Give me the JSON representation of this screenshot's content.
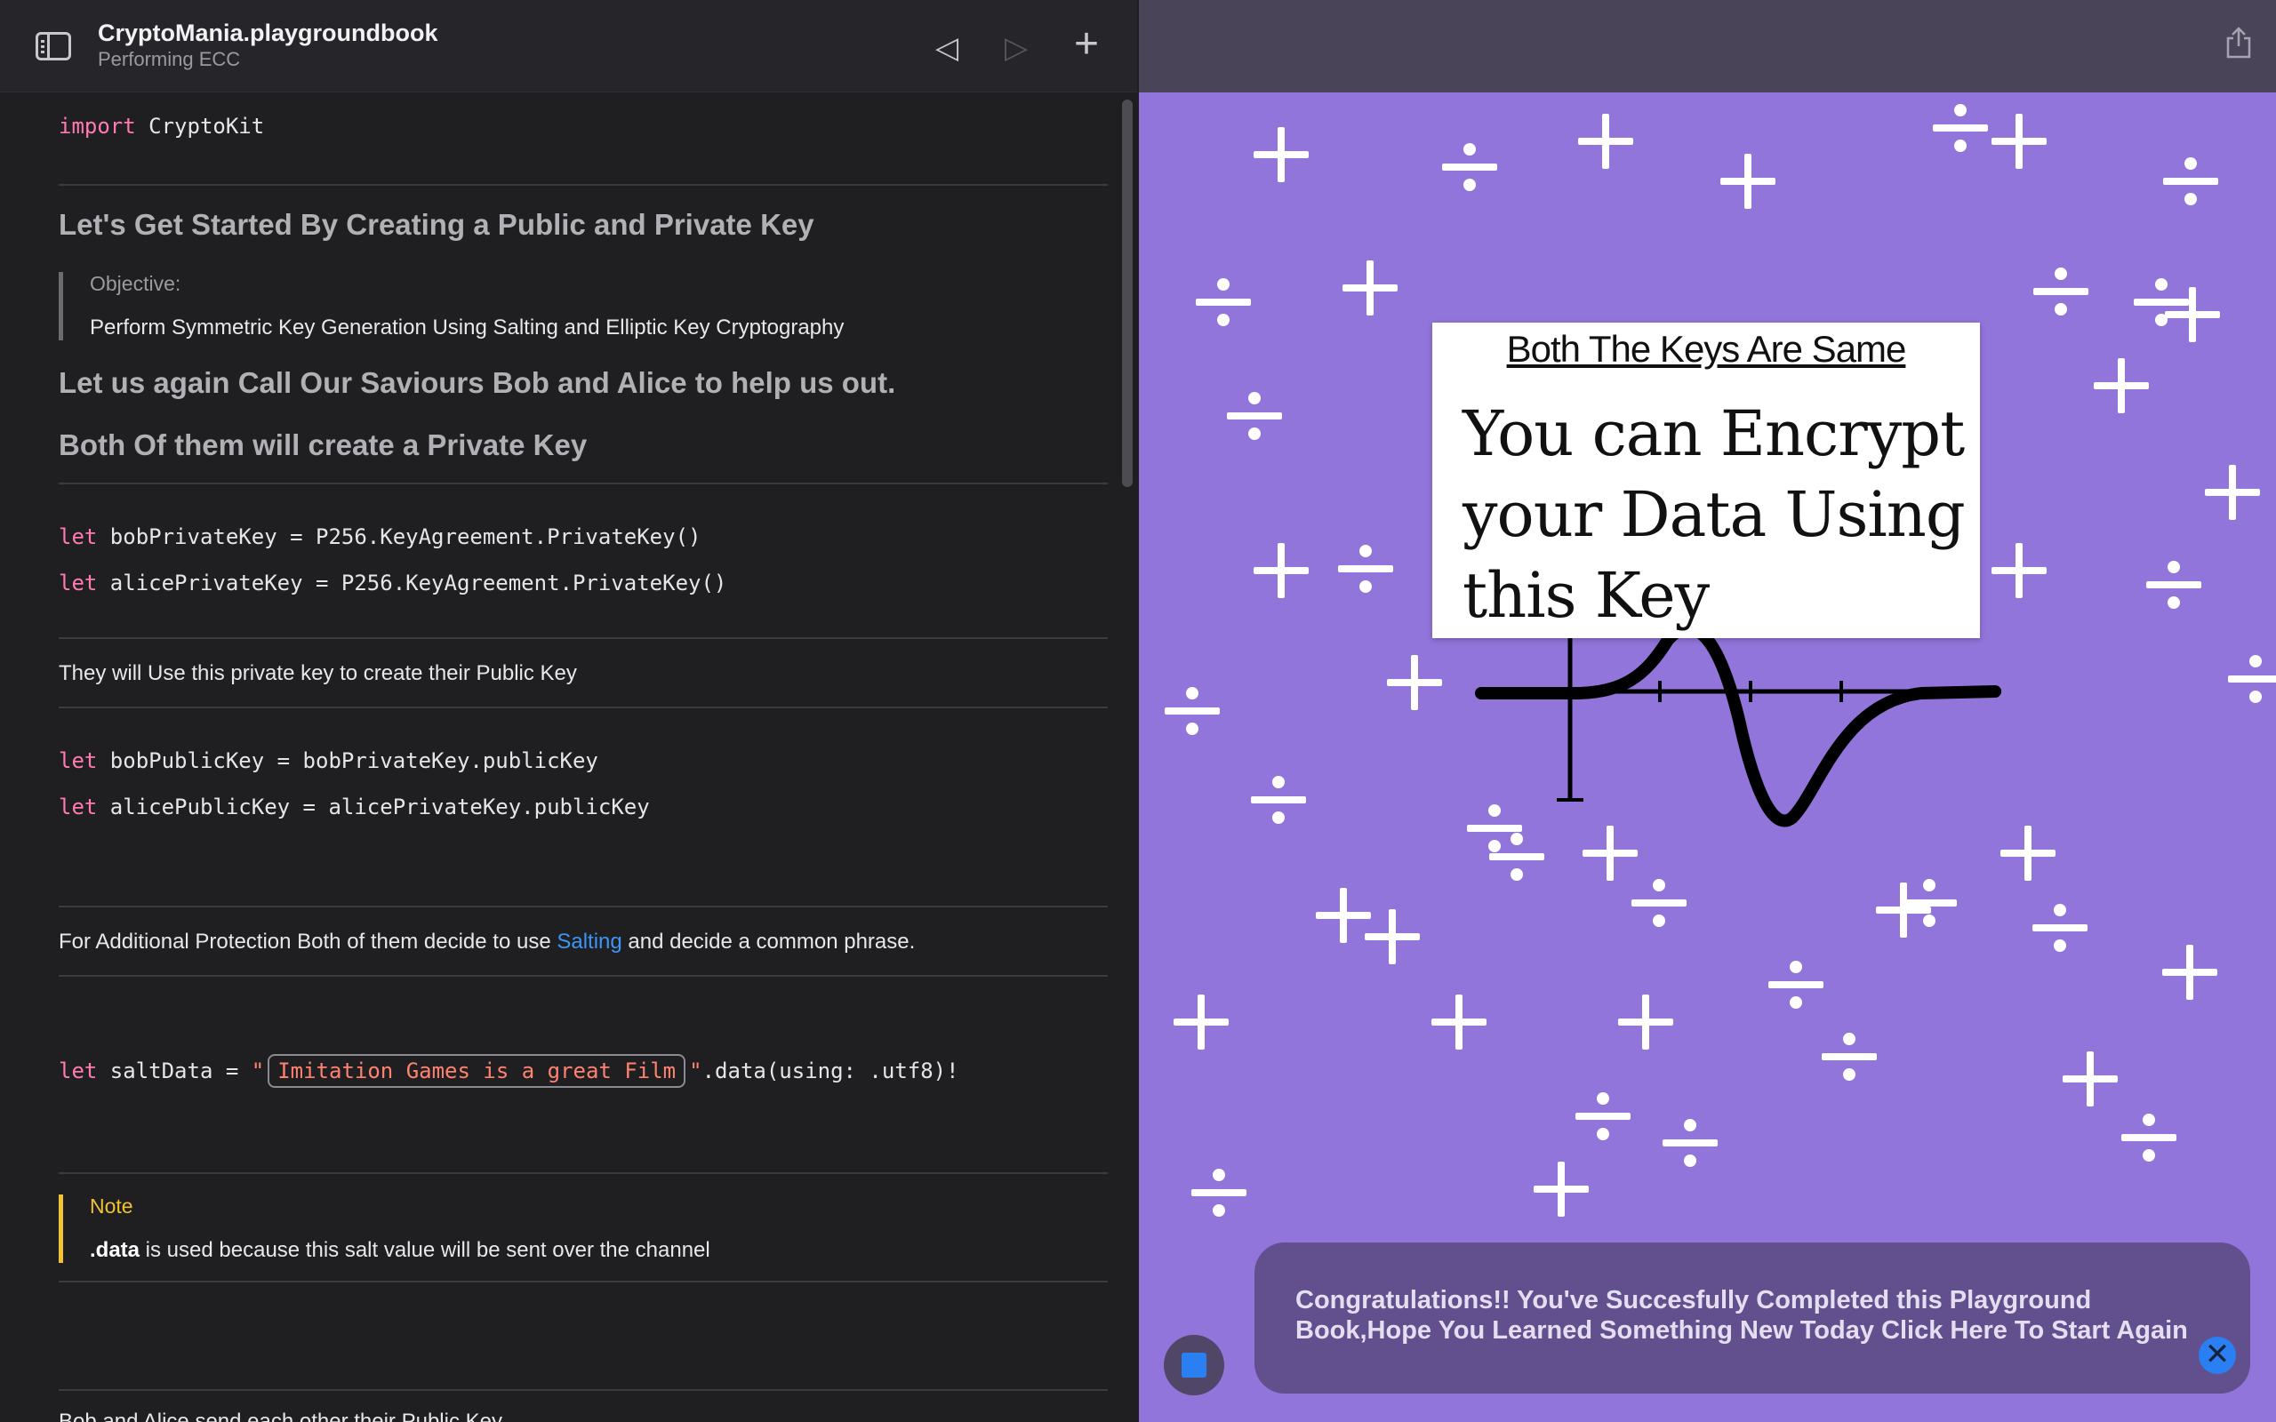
{
  "editor": {
    "title": "CryptoMania.playgroundbook",
    "subtitle": "Performing ECC",
    "icons": {
      "sidebar": "sidebar-toggle-icon",
      "back": "triangle-left-icon",
      "forward": "triangle-right-icon",
      "add": "plus-icon"
    },
    "glyphs": {
      "back": "◁",
      "forward": "▷",
      "add": "+"
    },
    "import_kw": "import",
    "import_name": "CryptoKit",
    "heading_1": "Let's Get Started By Creating a Public and Private Key",
    "objective_title": "Objective:",
    "objective_body": "Perform Symmetric Key Generation Using Salting and Elliptic Key Cryptography",
    "heading_2": "Let us again Call Our Saviours Bob and Alice to help us out.",
    "heading_3": "Both Of them will create a Private Key",
    "code_let": "let",
    "bob_private": " bobPrivateKey = P256.KeyAgreement.PrivateKey()",
    "alice_private": " alicePrivateKey = P256.KeyAgreement.PrivateKey()",
    "prose_public": "They will Use this private key to create their Public Key",
    "bob_public": " bobPublicKey = bobPrivateKey.publicKey",
    "alice_public": " alicePublicKey = alicePrivateKey.publicKey",
    "prose_salt_before": "For Additional Protection Both of them decide to use ",
    "prose_salt_link": "Salting",
    "prose_salt_after": " and decide a common phrase.",
    "salt_prefix": " saltData = ",
    "salt_quote_open": "\"",
    "salt_value": "Imitation Games is a great Film",
    "salt_quote_close": "\"",
    "salt_suffix": ".data(using: .utf8)!",
    "note_title": "Note",
    "note_bold": ".data",
    "note_body": " is used because this salt value will be sent over the channel",
    "prose_exchange": "Bob and Alice send each other their Public Key"
  },
  "liveview": {
    "share_icon": "share-icon",
    "card_caption": "Both The Keys Are Same",
    "card_message": "You can Encrypt your Data Using this Key",
    "toast_text": "Congratulations!! You've Succesfully Completed this Playground Book,Hope You Learned Something New Today Click Here To Start Again",
    "toast_close_glyph": "✕",
    "stop_icon": "stop-icon",
    "colors": {
      "background": "#9175db",
      "toast": "#62508e",
      "accent": "#2a7ff3"
    }
  }
}
